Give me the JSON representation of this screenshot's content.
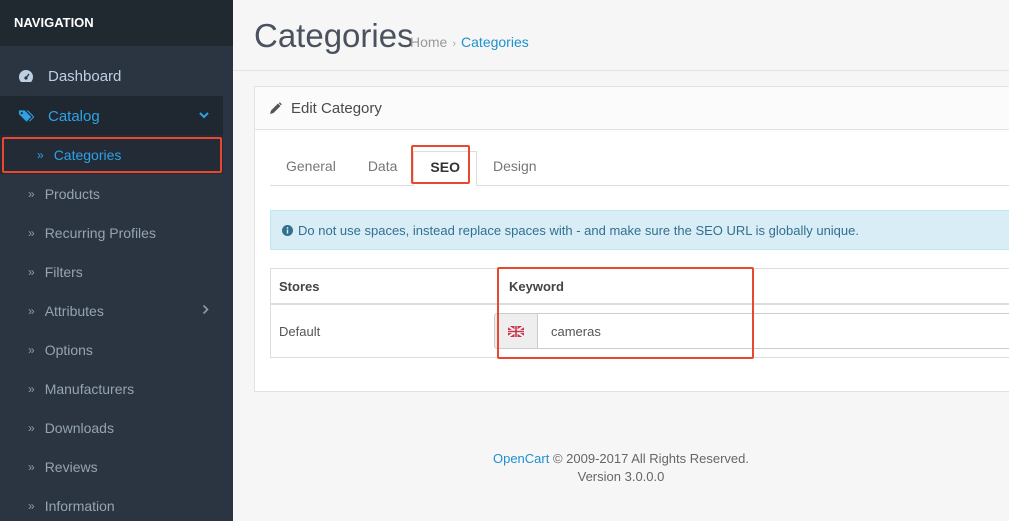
{
  "sidebar": {
    "header": "NAVIGATION",
    "dashboard": "Dashboard",
    "catalog": "Catalog",
    "items": [
      {
        "label": "Categories"
      },
      {
        "label": "Products"
      },
      {
        "label": "Recurring Profiles"
      },
      {
        "label": "Filters"
      },
      {
        "label": "Attributes"
      },
      {
        "label": "Options"
      },
      {
        "label": "Manufacturers"
      },
      {
        "label": "Downloads"
      },
      {
        "label": "Reviews"
      },
      {
        "label": "Information"
      }
    ]
  },
  "header": {
    "title": "Categories",
    "breadcrumb": {
      "home": "Home",
      "separator": "›",
      "current": "Categories"
    }
  },
  "panel": {
    "title": "Edit Category",
    "tabs": [
      "General",
      "Data",
      "SEO",
      "Design"
    ],
    "active_tab": "SEO",
    "alert": "Do not use spaces, instead replace spaces with - and make sure the SEO URL is globally unique.",
    "table": {
      "headers": {
        "stores": "Stores",
        "keyword": "Keyword"
      },
      "rows": [
        {
          "store": "Default",
          "keyword": "cameras"
        }
      ]
    }
  },
  "footer": {
    "brand": "OpenCart",
    "copyright": "© 2009-2017 All Rights Reserved.",
    "version": "Version 3.0.0.0"
  },
  "colors": {
    "accent": "#1e91cf",
    "sidebar_bg": "#2b3541",
    "highlight": "#e8492e",
    "alert_bg": "#d9edf7"
  }
}
